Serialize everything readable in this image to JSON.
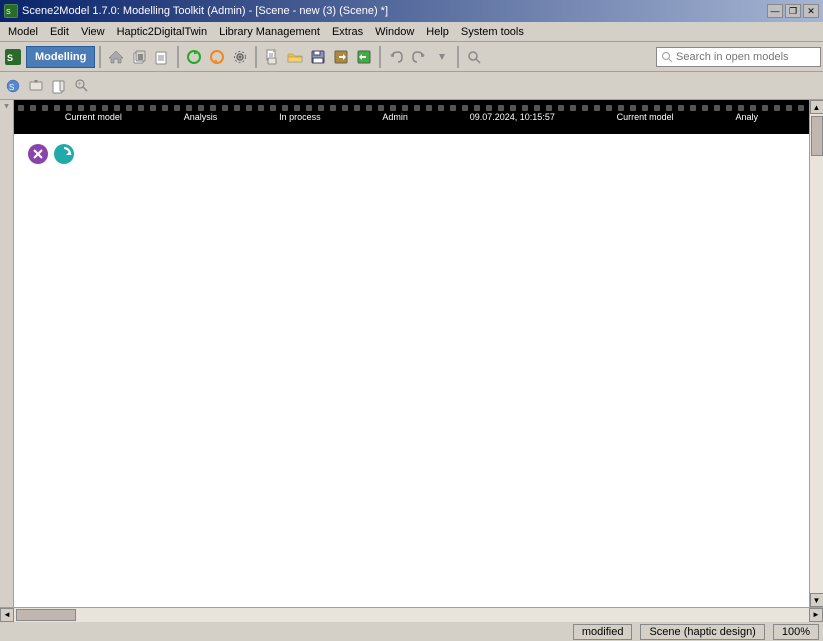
{
  "window": {
    "title": "Scene2Model 1.7.0: Modelling Toolkit (Admin) - [Scene - new (3) (Scene) *]",
    "title_icon": "S2M"
  },
  "title_controls": {
    "minimize": "—",
    "restore": "❐",
    "close": "✕",
    "inner_minimize": "—",
    "inner_restore": "❐",
    "inner_close": "✕"
  },
  "menu": {
    "items": [
      "Model",
      "Edit",
      "View",
      "Haptic2DigitalTwin",
      "Library Management",
      "Extras",
      "Window",
      "Help",
      "System tools"
    ]
  },
  "toolbar": {
    "modelling_label": "Modelling",
    "search_placeholder": "Search in open models",
    "buttons": [
      {
        "name": "home-icon",
        "symbol": "🏠"
      },
      {
        "name": "copy-icon",
        "symbol": "📋"
      },
      {
        "name": "paste-icon",
        "symbol": "📄"
      },
      {
        "name": "refresh1-icon",
        "symbol": "↺"
      },
      {
        "name": "refresh2-icon",
        "symbol": "↻"
      },
      {
        "name": "settings-icon",
        "symbol": "⚙"
      }
    ]
  },
  "toolbar2": {
    "buttons": [
      {
        "name": "new-icon",
        "symbol": "📄"
      },
      {
        "name": "open-icon",
        "symbol": "📂"
      },
      {
        "name": "save-icon",
        "symbol": "💾"
      },
      {
        "name": "export-icon",
        "symbol": "📤"
      },
      {
        "name": "import-icon",
        "symbol": "📥"
      },
      {
        "name": "arrow-left-icon",
        "symbol": "←"
      },
      {
        "name": "arrow-right-icon",
        "symbol": "→"
      },
      {
        "name": "arrow-down-icon",
        "symbol": "↓"
      },
      {
        "name": "separator1",
        "type": "sep"
      },
      {
        "name": "search2-icon",
        "symbol": "🔍"
      },
      {
        "name": "undo-icon",
        "symbol": "↩"
      },
      {
        "name": "redo-icon",
        "symbol": "↪"
      }
    ]
  },
  "film_strip": {
    "labels": [
      "Current model",
      "Analysis",
      "In process",
      "Admin",
      "09.07.2024, 10:15:57",
      "Current model",
      "Analy"
    ]
  },
  "canvas": {
    "icons": [
      {
        "name": "purple-circle-icon",
        "color": "purple",
        "symbol": "✕"
      },
      {
        "name": "teal-circle-icon",
        "color": "teal",
        "symbol": "↺"
      }
    ]
  },
  "status_bar": {
    "modified_label": "modified",
    "scene_label": "Scene (haptic design)",
    "zoom_label": "100%"
  },
  "scrollbar": {
    "up": "▲",
    "down": "▼",
    "left": "◄",
    "right": "►"
  }
}
